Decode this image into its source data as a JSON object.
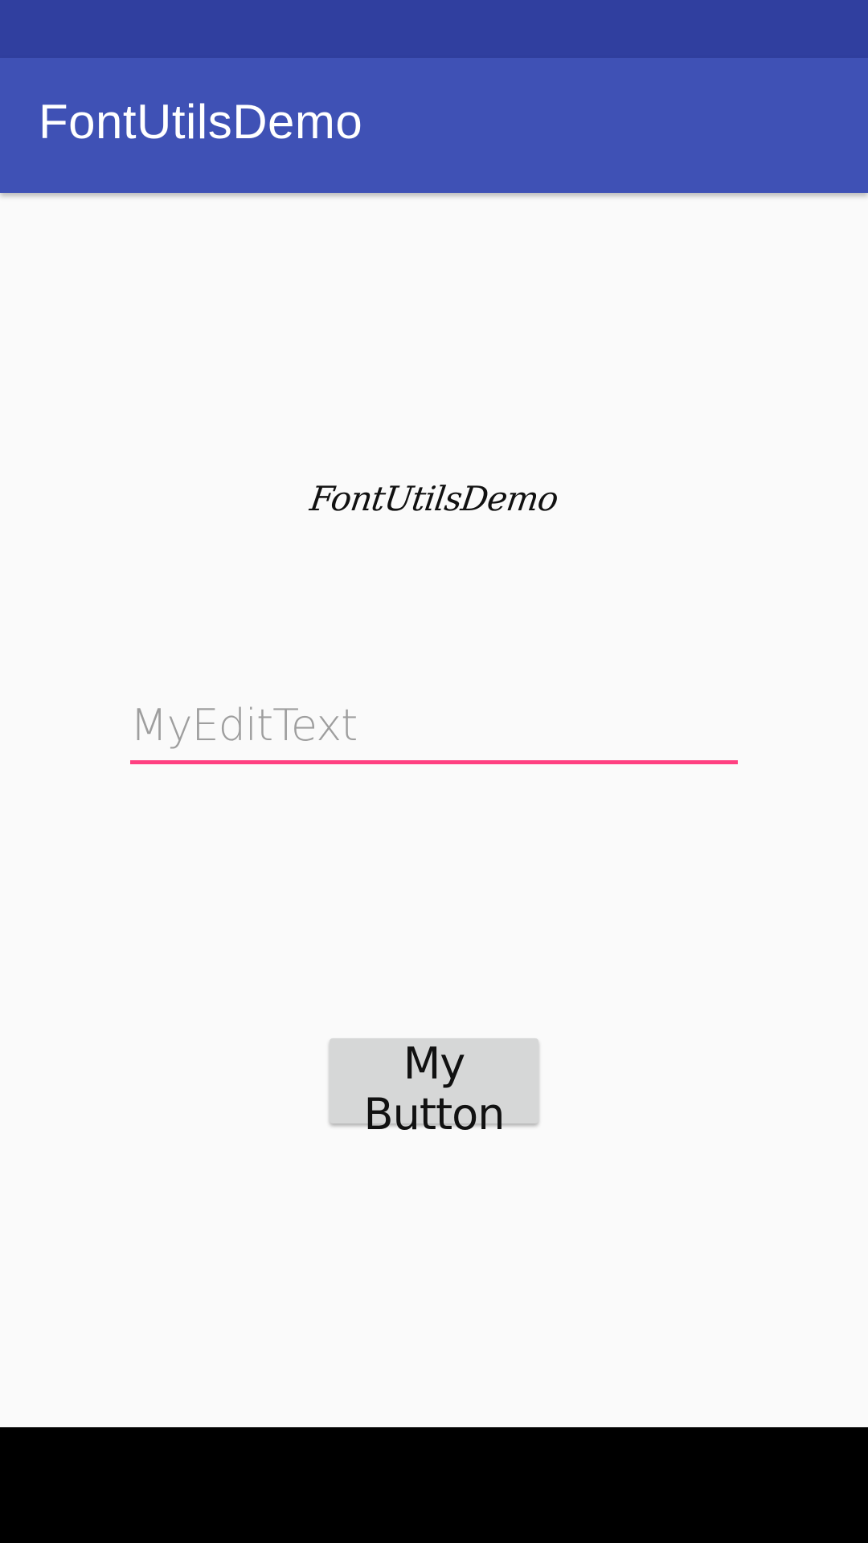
{
  "app_bar": {
    "title": "FontUtilsDemo"
  },
  "content": {
    "script_title": "FontUtilsDemo",
    "edit_text": {
      "value": "",
      "placeholder": "MyEditText"
    },
    "button_label": "My Button"
  },
  "colors": {
    "status_bar": "#303f9f",
    "app_bar": "#3f51b5",
    "accent": "#ff4081",
    "background": "#fafafa",
    "button": "#d6d7d7",
    "navigation_bar": "#000000"
  }
}
